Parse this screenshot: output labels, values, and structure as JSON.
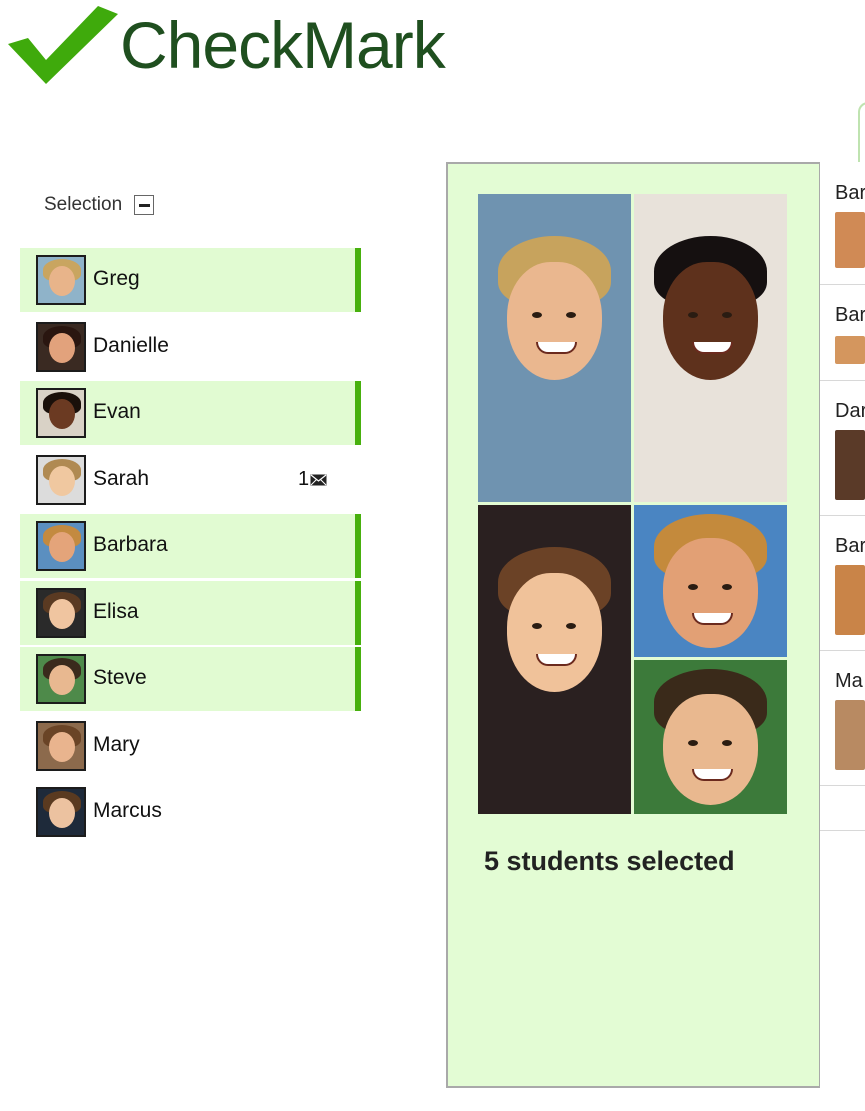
{
  "app": {
    "logo_text": "CheckMark",
    "accent_color": "#47b00d",
    "logo_color": "#1f4f1f"
  },
  "selection": {
    "label": "Selection",
    "toggle_icon": "minus-box-icon",
    "students": [
      {
        "name": "Greg",
        "selected": true,
        "photo": {
          "skin": "#e8b48a",
          "hair": "#c9a560",
          "bg": "#8fb3c9"
        }
      },
      {
        "name": "Danielle",
        "selected": false,
        "photo": {
          "skin": "#e2a27c",
          "hair": "#2a1610",
          "bg": "#3a2a22"
        }
      },
      {
        "name": "Evan",
        "selected": true,
        "photo": {
          "skin": "#6b3a22",
          "hair": "#1a100a",
          "bg": "#d9d2c6"
        }
      },
      {
        "name": "Sarah",
        "selected": false,
        "photo": {
          "skin": "#f0c8a0",
          "hair": "#b08a52",
          "bg": "#dcdcdc"
        },
        "mail_count": "1"
      },
      {
        "name": "Barbara",
        "selected": true,
        "photo": {
          "skin": "#e4a47a",
          "hair": "#c38a40",
          "bg": "#5b8fc0"
        }
      },
      {
        "name": "Elisa",
        "selected": true,
        "photo": {
          "skin": "#f0c5a0",
          "hair": "#5a3a22",
          "bg": "#2a2a2a"
        }
      },
      {
        "name": "Steve",
        "selected": true,
        "photo": {
          "skin": "#e8b890",
          "hair": "#3a2a1c",
          "bg": "#4e8a4a"
        }
      },
      {
        "name": "Mary",
        "selected": false,
        "photo": {
          "skin": "#e9b48e",
          "hair": "#6a4426",
          "bg": "#8c6a4c"
        }
      },
      {
        "name": "Marcus",
        "selected": false,
        "photo": {
          "skin": "#ecc2a0",
          "hair": "#5a3a20",
          "bg": "#1e2a3a"
        }
      }
    ]
  },
  "center": {
    "summary": "5 students selected",
    "photos": [
      {
        "skin": "#eab78f",
        "hair": "#c7a35d",
        "bg": "#6f93b0"
      },
      {
        "skin": "#5e311c",
        "hair": "#151010",
        "bg": "#e8e2da"
      },
      {
        "skin": "#f0c29a",
        "hair": "#6b4226",
        "bg": "#2a2020"
      },
      {
        "skin": "#e2a075",
        "hair": "#c48a3c",
        "bg": "#4a85c2"
      },
      {
        "skin": "#e9b88f",
        "hair": "#3a2a1a",
        "bg": "#3c7a3a"
      }
    ]
  },
  "right_panel": {
    "rows": [
      {
        "name": "Bar"
      },
      {
        "name": "Bar"
      },
      {
        "name": "Dar"
      },
      {
        "name": "Bar"
      },
      {
        "name": "Ma"
      }
    ]
  }
}
